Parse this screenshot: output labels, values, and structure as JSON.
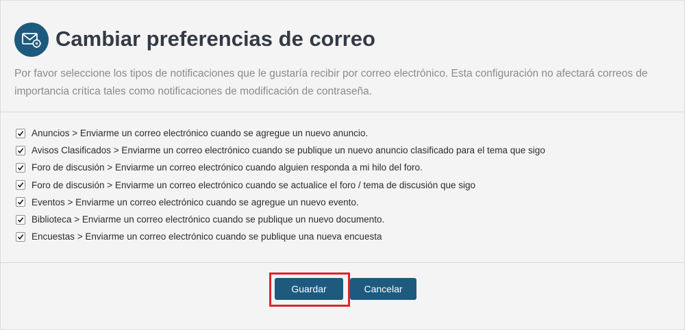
{
  "header": {
    "icon": "mail-settings-icon",
    "title": "Cambiar preferencias de correo",
    "description": "Por favor seleccione los tipos de notificaciones que le gustaría recibir por correo electrónico. Esta configuración no afectará correos de importancia crítica tales como notificaciones de modificación de contraseña."
  },
  "options": [
    {
      "label": "Anuncios > Enviarme un correo electrónico cuando se agregue un nuevo anuncio.",
      "checked": true
    },
    {
      "label": "Avisos Clasificados > Enviarme un correo electrónico cuando se publique un nuevo anuncio clasificado para el tema que sigo",
      "checked": true
    },
    {
      "label": "Foro de discusión > Enviarme un correo electrónico cuando alguien responda a mi hilo del foro.",
      "checked": true
    },
    {
      "label": "Foro de discusión > Enviarme un correo electrónico cuando se actualice el foro / tema de discusión que sigo",
      "checked": true
    },
    {
      "label": "Eventos > Enviarme un correo electrónico cuando se agregue un nuevo evento.",
      "checked": true
    },
    {
      "label": "Biblioteca > Enviarme un correo electrónico cuando se publique un nuevo documento.",
      "checked": true
    },
    {
      "label": "Encuestas > Enviarme un correo electrónico cuando se publique una nueva encuesta",
      "checked": true
    }
  ],
  "actions": {
    "save_label": "Guardar",
    "cancel_label": "Cancelar",
    "highlight_color": "#e3202e",
    "button_color": "#1d5a7e"
  }
}
